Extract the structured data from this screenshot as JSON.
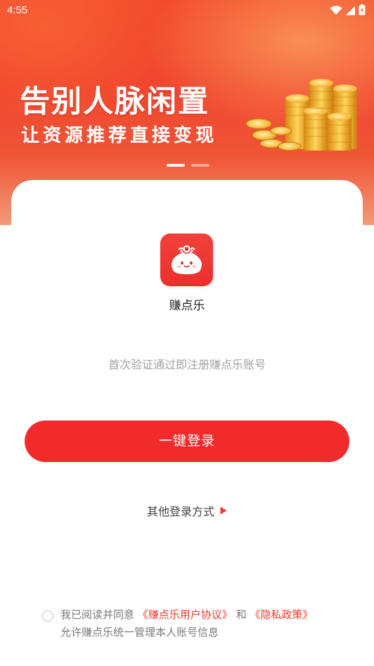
{
  "status_bar": {
    "time": "4:55",
    "icons": [
      "wifi-icon",
      "signal-icon",
      "battery-icon"
    ]
  },
  "banner": {
    "headline": "告别人脉闲置",
    "subline": "让资源推荐直接变现",
    "carousel": {
      "total": 2,
      "active_index": 0
    }
  },
  "app": {
    "name": "赚点乐",
    "logo_icon": "money-bag-mascot-icon"
  },
  "hint": "首次验证通过即注册赚点乐账号",
  "login_button": "一键登录",
  "other_login": {
    "label": "其他登录方式",
    "icon": "triangle-right-icon"
  },
  "agreement": {
    "checked": false,
    "prefix": "我已阅读并同意 ",
    "user_agreement": "《赚点乐用户协议》",
    "and": " 和 ",
    "privacy_policy": "《隐私政策》",
    "second_line": "允许赚点乐统一管理本人账号信息"
  },
  "colors": {
    "brand_red": "#f12a2a",
    "link_red": "#f03a2e",
    "hint_gray": "#a3a3a3"
  }
}
